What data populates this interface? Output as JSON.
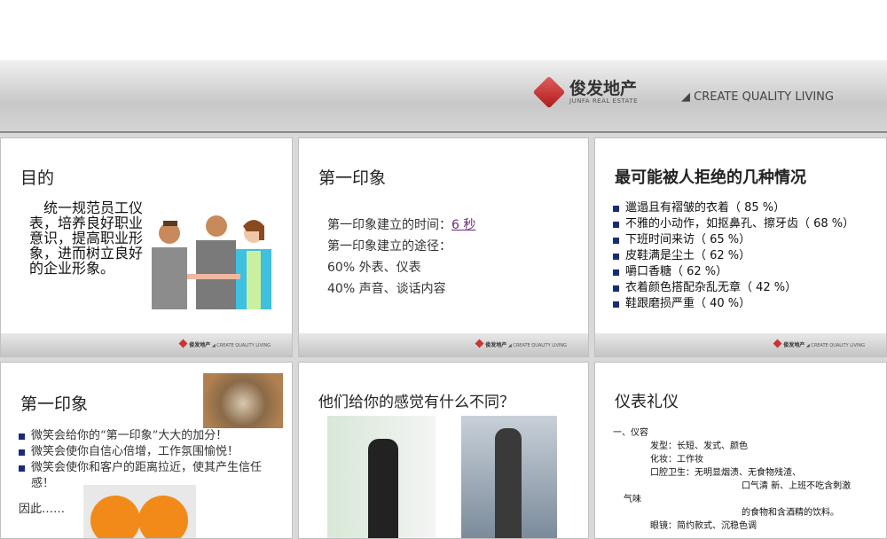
{
  "banner": {
    "brand_cn": "俊发地产",
    "brand_en": "JUNFA REAL ESTATE",
    "tagline": "CREATE QUALITY LIVING"
  },
  "slides": [
    {
      "title": "目的",
      "body": "统一规范员工仪表，培养良好职业意识，提高职业形象，进而树立良好的企业形象。"
    },
    {
      "title": "第一印象",
      "lines": [
        "第一印象建立的时间：",
        "第一印象建立的途径：",
        "60% 外表、仪表",
        "40% 声音、谈话内容"
      ],
      "link": "6 秒"
    },
    {
      "title": "最可能被人拒绝的几种情况",
      "items": [
        "邋遢且有褶皱的衣着（ 85 %）",
        "不雅的小动作，如抠鼻孔、擦牙齿（ 68 %）",
        "下班时间来访（ 65 %）",
        "皮鞋满是尘土（ 62 %）",
        "嚼口香糖（ 62 %）",
        "衣着颜色搭配杂乱无章（ 42 %）",
        "鞋跟磨损严重（ 40 %）"
      ]
    },
    {
      "title": "第一印象",
      "items": [
        "微笑会给你的“第一印象”大大的加分！",
        "微笑会使你自信心倍增，工作氛围愉悦！",
        "微笑会使你和客户的距离拉近，使其产生信任感！"
      ],
      "after": "因此……"
    },
    {
      "title": "他们给你的感觉有什么不同？"
    },
    {
      "title": "仪表礼仪",
      "lines": [
        "一、仪容",
        "发型：长短、发式、颜色",
        "化妆：工作妆",
        "口腔卫生：无明显烟渍、无食物残渣、",
        "口气清 新、上班不吃含刺激",
        "气味",
        "的食物和含酒精的饮料。",
        "眼镜：简约款式、沉稳色调"
      ]
    }
  ],
  "footer": {
    "brand_cn": "俊发地产",
    "tagline": "CREATE QUALITY LIVING"
  }
}
